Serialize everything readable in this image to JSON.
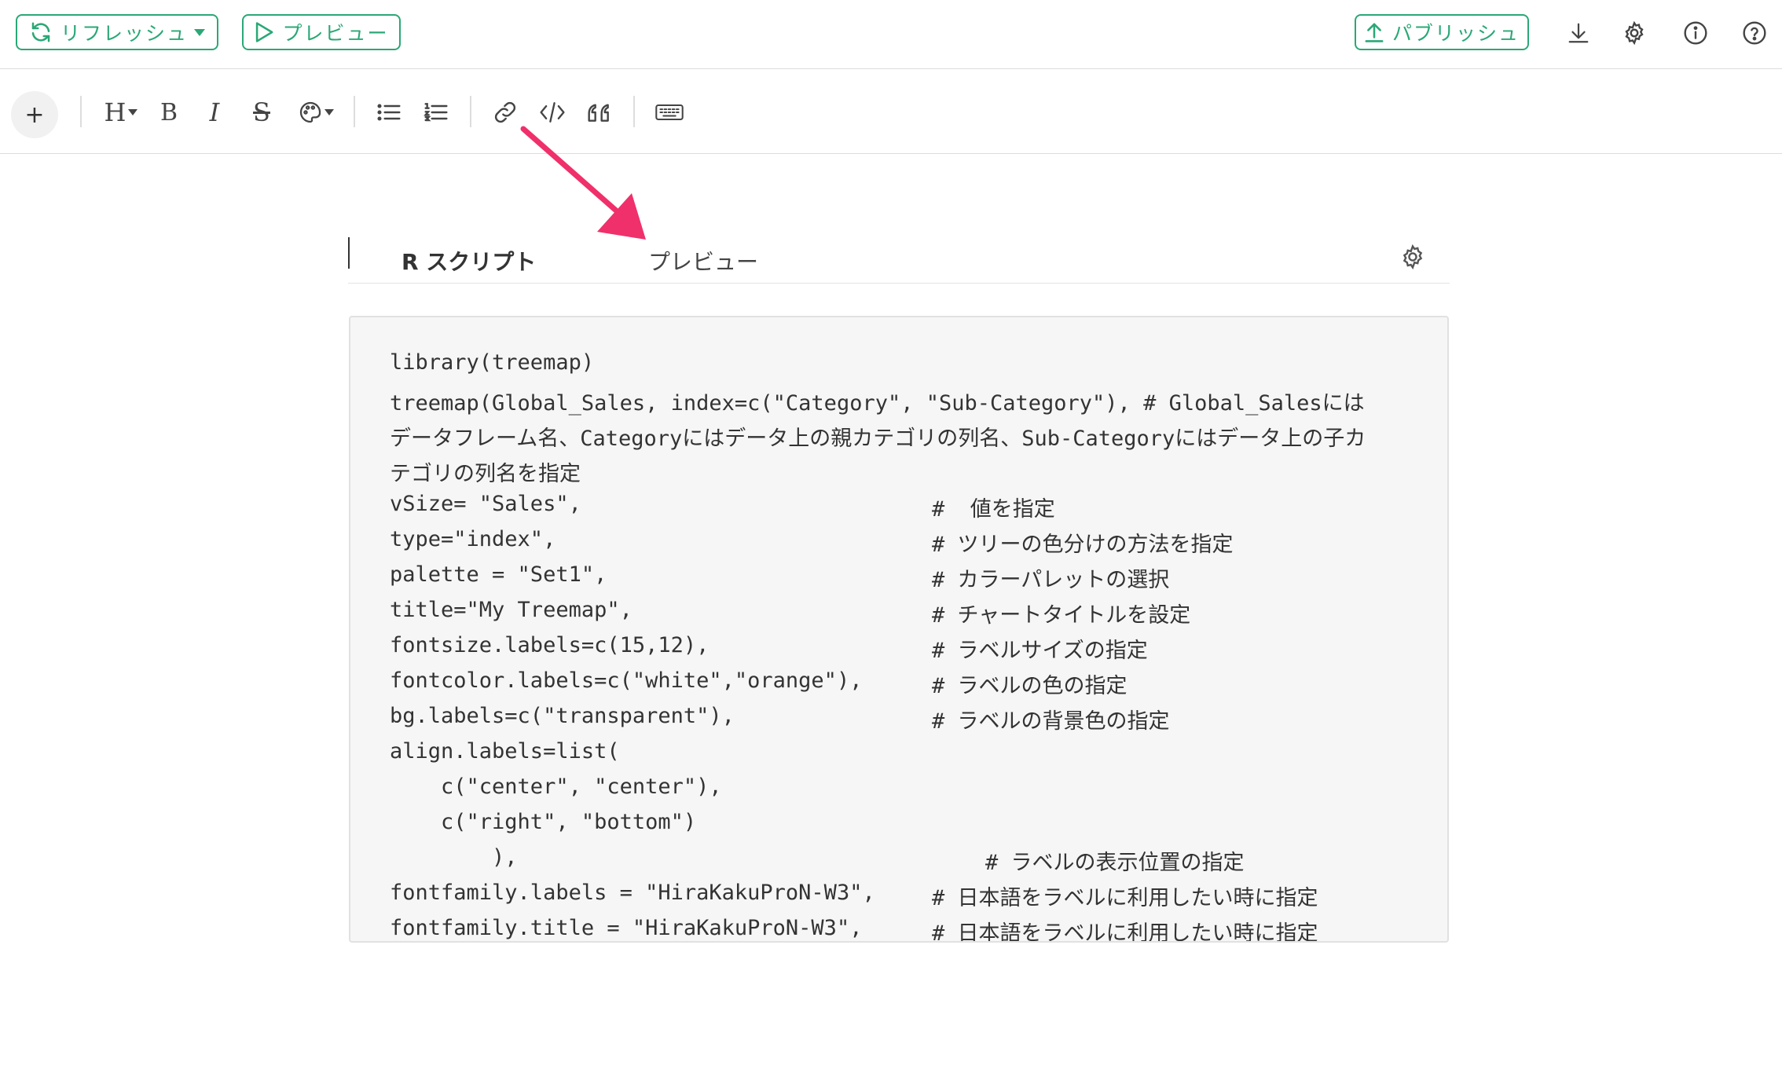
{
  "topbar": {
    "refresh_label": "リフレッシュ",
    "preview_label": "プレビュー",
    "publish_label": "パブリッシュ",
    "icons": [
      "download-icon",
      "gear-icon",
      "info-icon",
      "help-icon"
    ],
    "accent": "#2aa876"
  },
  "toolbar": {
    "add_label": "+",
    "heading_label": "H",
    "bold_label": "B",
    "italic_label": "I",
    "strike_label": "S",
    "icons": [
      "palette-icon",
      "bullet-list-icon",
      "numbered-list-icon",
      "link-icon",
      "code-icon",
      "quote-icon",
      "keyboard-icon"
    ]
  },
  "tabs": {
    "script_label": "R スクリプト",
    "preview_label": "プレビュー"
  },
  "annotation": {
    "arrow_color": "#f0306a"
  },
  "code": {
    "lines": [
      "library(treemap)",
      "treemap(Global_Sales, index=c(\"Category\", \"Sub-Category\"), # Global_Salesには",
      "データフレーム名、Categoryにはデータ上の親カテゴリの列名、Sub-Categoryにはデータ上の子カ",
      "テゴリの列名を指定",
      "vSize= \"Sales\",",
      "type=\"index\",",
      "palette = \"Set1\",",
      "title=\"My Treemap\",",
      "fontsize.labels=c(15,12),",
      "fontcolor.labels=c(\"white\",\"orange\"),",
      "bg.labels=c(\"transparent\"),",
      "align.labels=list(",
      "    c(\"center\", \"center\"),",
      "    c(\"right\", \"bottom\")",
      "        ),",
      "fontfamily.labels = \"HiraKakuProN-W3\",",
      "fontfamily.title = \"HiraKakuProN-W3\","
    ],
    "comments": [
      "#  値を指定",
      "# ツリーの色分けの方法を指定",
      "# カラーパレットの選択",
      "# チャートタイトルを設定",
      "# ラベルサイズの指定",
      "# ラベルの色の指定",
      "# ラベルの背景色の指定",
      "# ラベルの表示位置の指定",
      "# 日本語をラベルに利用したい時に指定",
      "# 日本語をラベルに利用したい時に指定"
    ]
  }
}
